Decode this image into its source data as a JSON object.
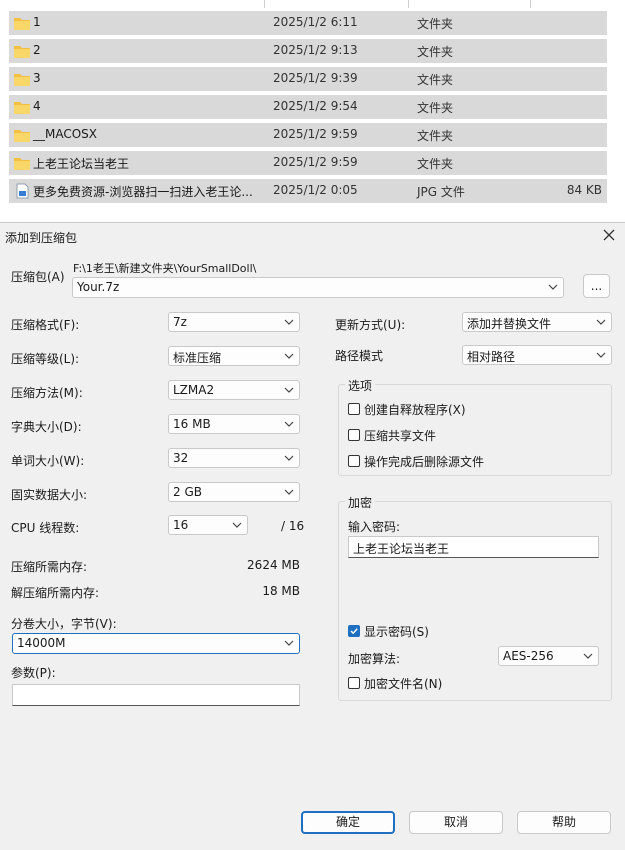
{
  "explorer": {
    "rows": [
      {
        "name": "1",
        "date": "2025/1/2 6:11",
        "type": "文件夹",
        "size": "",
        "icon": "folder-icon"
      },
      {
        "name": "2",
        "date": "2025/1/2 9:13",
        "type": "文件夹",
        "size": "",
        "icon": "folder-icon"
      },
      {
        "name": "3",
        "date": "2025/1/2 9:39",
        "type": "文件夹",
        "size": "",
        "icon": "folder-icon"
      },
      {
        "name": "4",
        "date": "2025/1/2 9:54",
        "type": "文件夹",
        "size": "",
        "icon": "folder-icon"
      },
      {
        "name": "__MACOSX",
        "date": "2025/1/2 9:59",
        "type": "文件夹",
        "size": "",
        "icon": "folder-icon"
      },
      {
        "name": "上老王论坛当老王",
        "date": "2025/1/2 9:59",
        "type": "文件夹",
        "size": "",
        "icon": "folder-icon"
      },
      {
        "name": "更多免费资源-浏览器扫一扫进入老王论...",
        "date": "2025/1/2 0:05",
        "type": "JPG 文件",
        "size": "84 KB",
        "icon": "image-file-icon"
      }
    ]
  },
  "dialog": {
    "title": "添加到压缩包",
    "close_icon": "close-icon",
    "archive": {
      "label": "压缩包(A)",
      "path": "F:\\1老王\\新建文件夹\\YourSmallDoll\\",
      "value": "Your.7z",
      "browse_label": "..."
    },
    "left": {
      "format": {
        "label": "压缩格式(F):",
        "value": "7z"
      },
      "level": {
        "label": "压缩等级(L):",
        "value": "标准压缩"
      },
      "method": {
        "label": "压缩方法(M):",
        "value": "LZMA2"
      },
      "dict": {
        "label": "字典大小(D):",
        "value": "16 MB"
      },
      "word": {
        "label": "单词大小(W):",
        "value": "32"
      },
      "solid": {
        "label": "固实数据大小:",
        "value": "2 GB"
      },
      "cpu": {
        "label": "CPU 线程数:",
        "value": "16",
        "total": "/ 16"
      },
      "mem_compress": {
        "label": "压缩所需内存:",
        "value": "2624 MB"
      },
      "mem_decompress": {
        "label": "解压缩所需内存:",
        "value": "18 MB"
      },
      "volume": {
        "label": "分卷大小，字节(V):",
        "value": "14000M"
      },
      "params": {
        "label": "参数(P):",
        "value": ""
      }
    },
    "right": {
      "update": {
        "label": "更新方式(U):",
        "value": "添加并替换文件"
      },
      "pathmode": {
        "label": "路径模式",
        "value": "相对路径"
      },
      "options": {
        "title": "选项",
        "sfx": {
          "label": "创建自释放程序(X)",
          "checked": false
        },
        "shared": {
          "label": "压缩共享文件",
          "checked": false
        },
        "delete_after": {
          "label": "操作完成后删除源文件",
          "checked": false
        }
      },
      "encryption": {
        "title": "加密",
        "password_label": "输入密码:",
        "password_value": "上老王论坛当老王",
        "show_password": {
          "label": "显示密码(S)",
          "checked": true
        },
        "method": {
          "label": "加密算法:",
          "value": "AES-256"
        },
        "encrypt_names": {
          "label": "加密文件名(N)",
          "checked": false
        }
      }
    },
    "buttons": {
      "ok": "确定",
      "cancel": "取消",
      "help": "帮助"
    }
  },
  "colors": {
    "accent": "#1f6fc2",
    "folder": "#f3c042",
    "row_bg": "#d9d9d9",
    "dialog_bg": "#f0f0f0"
  }
}
